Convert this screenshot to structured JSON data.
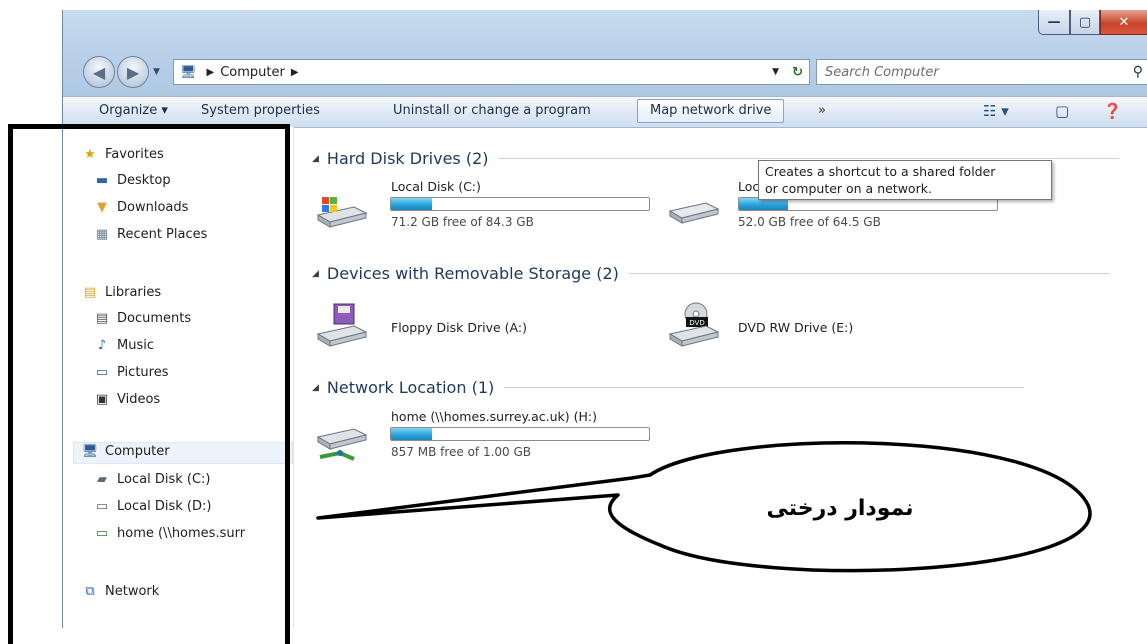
{
  "window": {
    "caption_buttons": {
      "minimize": "—",
      "maximize": "▢",
      "close": "✕"
    }
  },
  "address": {
    "crumb": "Computer",
    "search_placeholder": "Search Computer"
  },
  "toolbar": {
    "organize": "Organize ▾",
    "system_properties": "System properties",
    "uninstall": "Uninstall or change a program",
    "map_network": "Map network drive",
    "more": "»"
  },
  "tooltip": {
    "line1": "Creates a shortcut to a shared folder",
    "line2": "or computer on a network."
  },
  "nav": {
    "favorites": "Favorites",
    "desktop": "Desktop",
    "downloads": "Downloads",
    "recent": "Recent Places",
    "libraries": "Libraries",
    "documents": "Documents",
    "music": "Music",
    "pictures": "Pictures",
    "videos": "Videos",
    "computer": "Computer",
    "local_c": "Local Disk (C:)",
    "local_d": "Local Disk (D:)",
    "home": "home (\\\\homes.surr",
    "network": "Network"
  },
  "groups": {
    "hdd": "Hard Disk Drives (2)",
    "removable": "Devices with Removable Storage (2)",
    "network": "Network Location (1)"
  },
  "drives": {
    "c": {
      "name": "Local Disk (C:)",
      "free": "71.2 GB free of 84.3 GB",
      "used_fraction": 0.16
    },
    "d": {
      "name": "Local Disk (D:)",
      "free": "52.0 GB free of 64.5 GB",
      "used_fraction": 0.19
    },
    "a": {
      "name": "Floppy Disk Drive (A:)"
    },
    "e": {
      "name": "DVD RW Drive (E:)"
    },
    "h": {
      "name": "home (\\\\homes.surrey.ac.uk) (H:)",
      "free": "857 MB free of 1.00 GB",
      "used_fraction": 0.16
    }
  },
  "annotation": {
    "callout_text": "نمودار درختی"
  },
  "colors": {
    "progress": "#26a0da",
    "chrome": "#b9d0e8",
    "close_button": "#c8452c"
  }
}
